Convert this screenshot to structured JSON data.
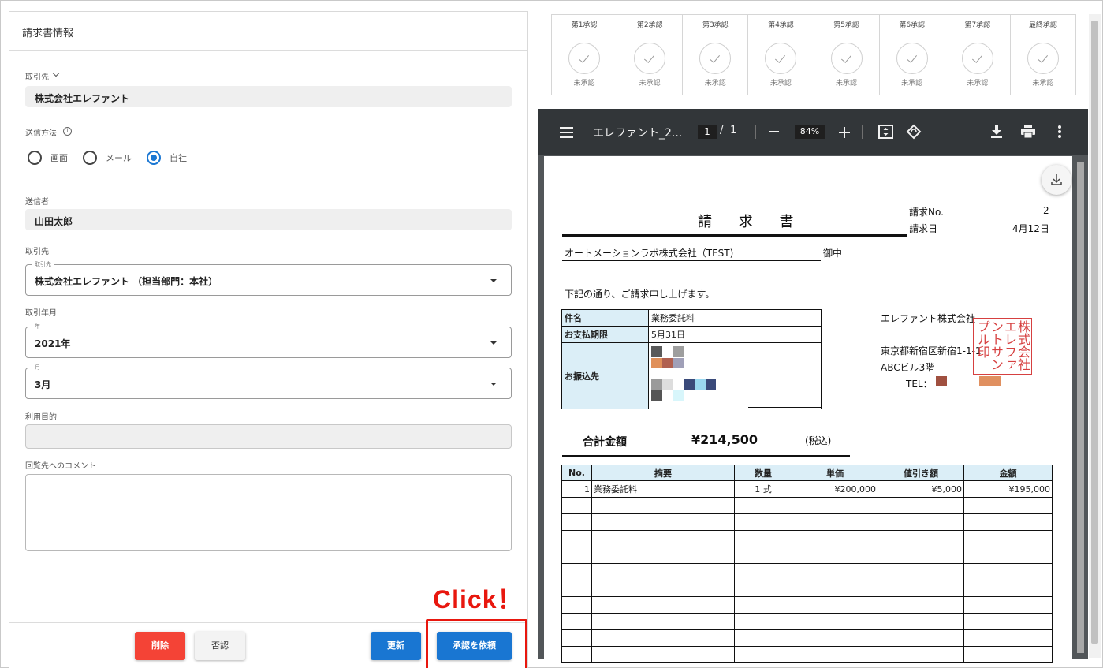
{
  "form": {
    "section_title": "請求書情報",
    "partner_label": "取引先",
    "partner_value": "株式会社エレファント",
    "send_method_label": "送信方法",
    "send_methods": [
      "画面",
      "メール",
      "自社"
    ],
    "send_method_selected": "自社",
    "sender_label": "送信者",
    "sender_value": "山田太郎",
    "partner2_label": "取引先",
    "partner2_legend": "取引先",
    "partner2_value": "株式会社エレファント （担当部門：本社）",
    "period_label": "取引年月",
    "year_legend": "年",
    "year_value": "2021年",
    "month_legend": "月",
    "month_value": "3月",
    "purpose_label": "利用目的",
    "purpose_value": "",
    "comment_label": "回覧先へのコメント",
    "comment_value": ""
  },
  "buttons": {
    "delete": "削除",
    "reject": "否認",
    "update": "更新",
    "request_approval": "承認を依頼"
  },
  "annotation": {
    "click": "Click！"
  },
  "approvals": [
    {
      "label": "第1承認",
      "status": "未承認"
    },
    {
      "label": "第2承認",
      "status": "未承認"
    },
    {
      "label": "第3承認",
      "status": "未承認"
    },
    {
      "label": "第4承認",
      "status": "未承認"
    },
    {
      "label": "第5承認",
      "status": "未承認"
    },
    {
      "label": "第6承認",
      "status": "未承認"
    },
    {
      "label": "第7承認",
      "status": "未承認"
    },
    {
      "label": "最終承認",
      "status": "未承認"
    }
  ],
  "viewer": {
    "file_name": "エレファント_2...",
    "page_current": "1",
    "page_sep": "/",
    "page_total": "1",
    "zoom": "84%"
  },
  "invoice": {
    "title": "請 求 書",
    "no_label": "請求No.",
    "no_value": "2",
    "date_label": "請求日",
    "date_value": "4月12日",
    "addressee": "オートメーションラボ株式会社（TEST)",
    "honorific": "御中",
    "intro": "下記の通り、ご請求申し上げます。",
    "subject_label": "件名",
    "subject_value": "業務委託料",
    "due_label": "お支払期限",
    "due_value": "5月31日",
    "bank_label": "お振込先",
    "issuer": "エレファント株式会社",
    "issuer_address": "東京都新宿区新宿1-1-1",
    "issuer_building": "ABCビル3階",
    "issuer_tel": "TEL：",
    "stamp_text": "株式会社エレファントサンプル印",
    "total_label": "合計金額",
    "total_value": "¥214,500",
    "tax_note": "(税込)",
    "columns": [
      "No.",
      "摘要",
      "数量",
      "単価",
      "値引き額",
      "金額"
    ],
    "rows": [
      {
        "no": "1",
        "desc": "業務委託料",
        "qty": "1 式",
        "unit": "¥200,000",
        "discount": "¥5,000",
        "amount": "¥195,000"
      }
    ]
  },
  "colors": {
    "primary": "#1976d2",
    "danger": "#f44336",
    "annotation": "#e8170e",
    "viewer_bar": "#323639",
    "table_header": "#dbeef7"
  }
}
